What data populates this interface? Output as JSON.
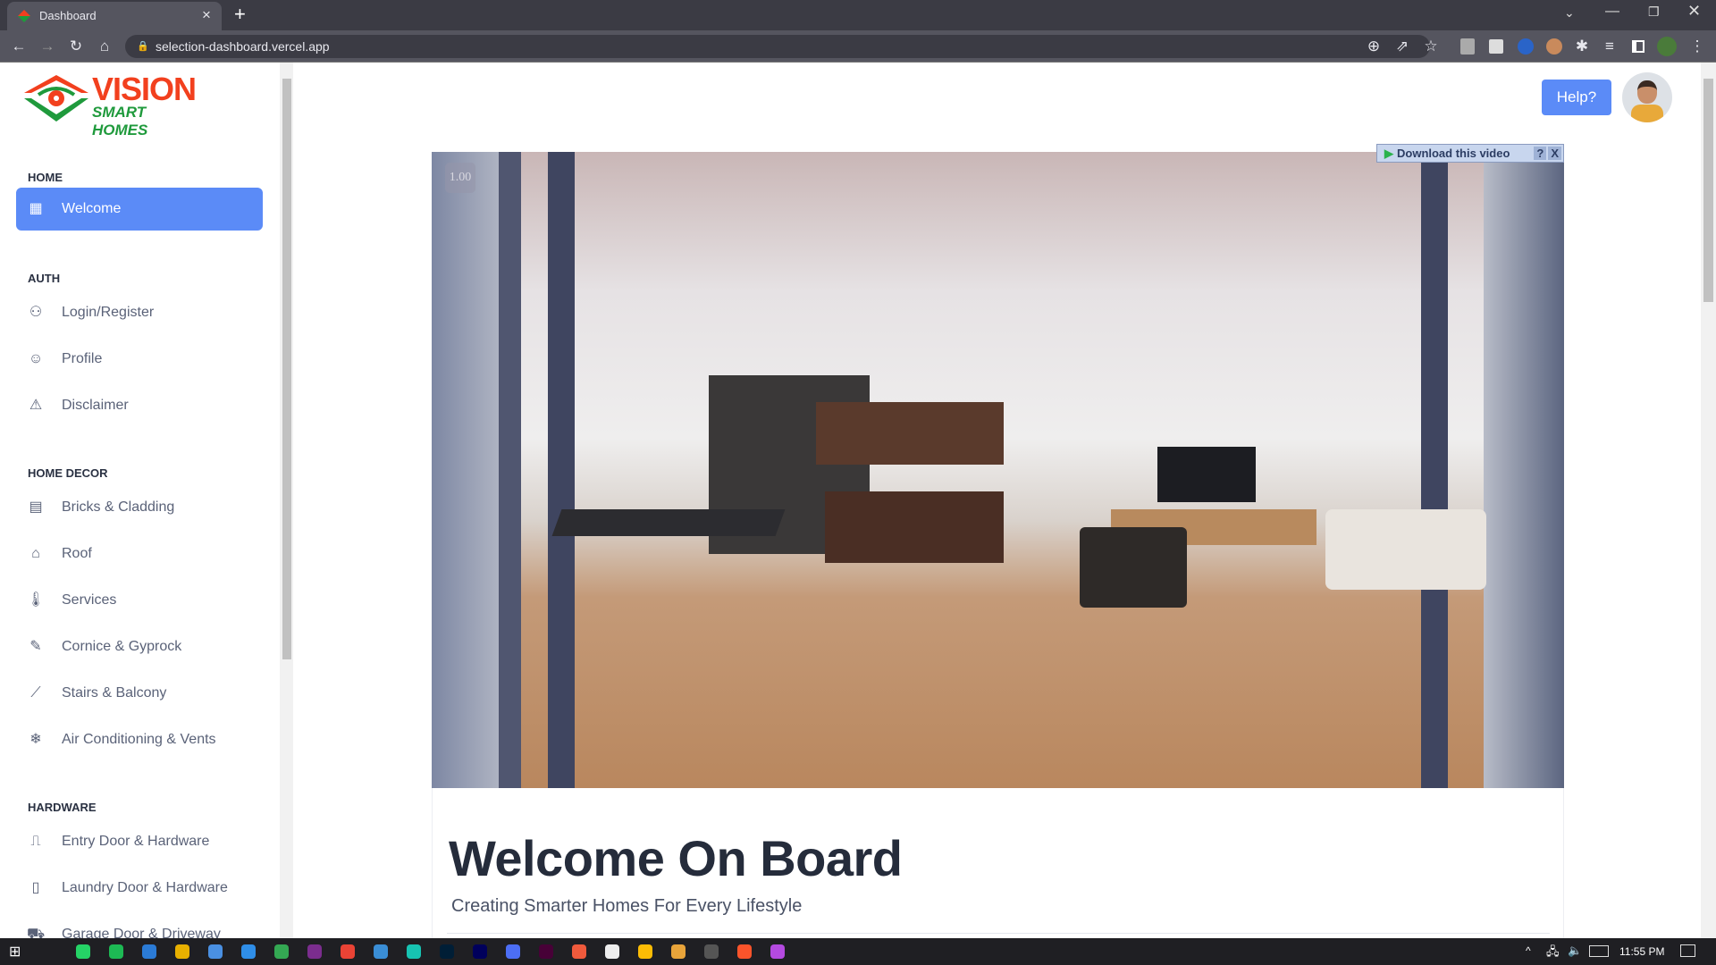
{
  "browser": {
    "tab_title": "Dashboard",
    "url": "selection-dashboard.vercel.app",
    "new_tab": "+",
    "close_tab": "×"
  },
  "sidebar": {
    "logo": {
      "brand": "VISION",
      "tagline": "SMART HOMES"
    },
    "sections": [
      {
        "label": "HOME",
        "items": [
          {
            "label": "Welcome",
            "icon": "grid-icon",
            "active": true
          }
        ]
      },
      {
        "label": "AUTH",
        "items": [
          {
            "label": "Login/Register",
            "icon": "user-plus-icon"
          },
          {
            "label": "Profile",
            "icon": "smiley-icon"
          },
          {
            "label": "Disclaimer",
            "icon": "warning-icon"
          }
        ]
      },
      {
        "label": "HOME DECOR",
        "items": [
          {
            "label": "Bricks & Cladding",
            "icon": "bricks-icon"
          },
          {
            "label": "Roof",
            "icon": "roof-icon"
          },
          {
            "label": "Services",
            "icon": "thermometer-icon"
          },
          {
            "label": "Cornice & Gyprock",
            "icon": "ruler-pen-icon"
          },
          {
            "label": "Stairs & Balcony",
            "icon": "stairs-icon"
          },
          {
            "label": "Air Conditioning & Vents",
            "icon": "air-conditioner-icon"
          }
        ]
      },
      {
        "label": "HARDWARE",
        "items": [
          {
            "label": "Entry Door & Hardware",
            "icon": "door-open-icon"
          },
          {
            "label": "Laundry Door & Hardware",
            "icon": "door-icon"
          },
          {
            "label": "Garage Door & Driveway",
            "icon": "car-icon"
          }
        ]
      }
    ]
  },
  "header": {
    "help_label": "Help?"
  },
  "main": {
    "video_speed": "1.00",
    "download_label": "Download this video",
    "download_help": "?",
    "download_close": "X",
    "title": "Welcome On Board",
    "subtitle": "Creating Smarter Homes For Every Lifestyle"
  },
  "taskbar": {
    "time": "11:55 PM"
  },
  "colors": {
    "accent": "#5b8bf7",
    "logo_red": "#f2401e",
    "logo_green": "#1f9a3c"
  }
}
